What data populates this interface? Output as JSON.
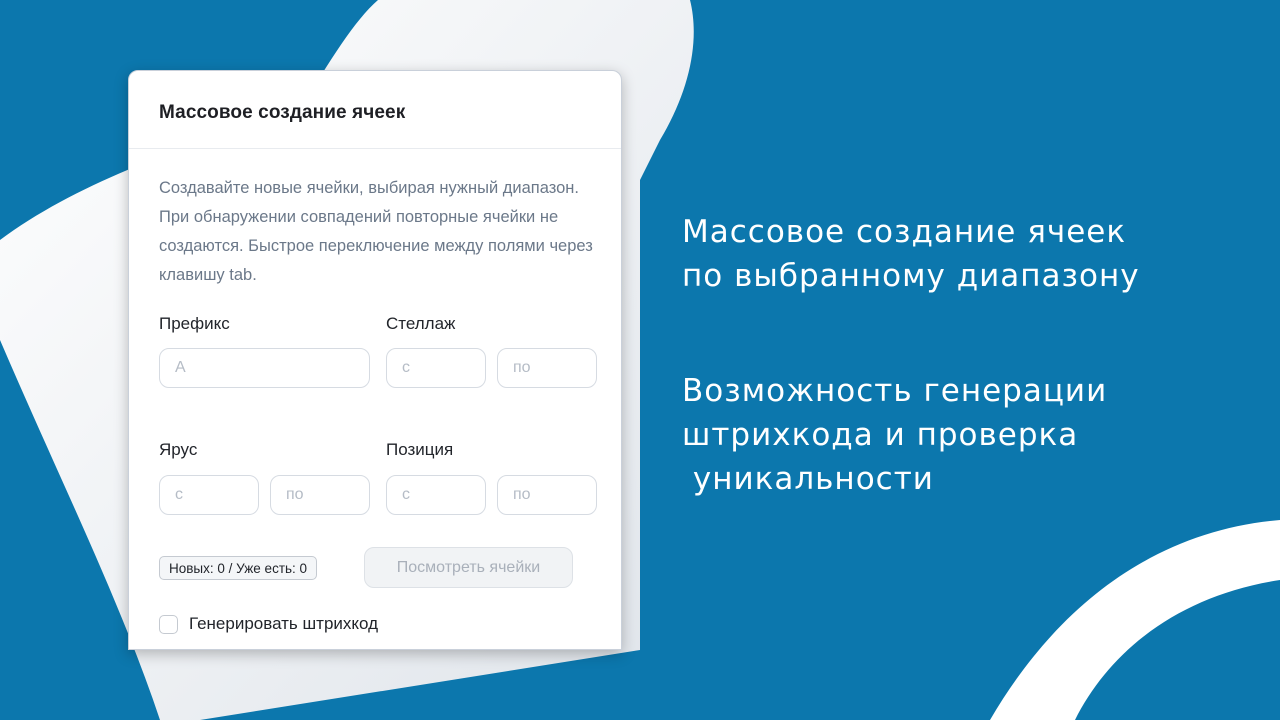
{
  "dialog": {
    "title": "Массовое создание ячеек",
    "description": "Создавайте новые ячейки, выбирая нужный диапазон. При обнаружении совпадений повторные ячейки не создаются. Быстрое переключение между полями через клавишу tab.",
    "prefix": {
      "label": "Префикс",
      "placeholder": "A"
    },
    "rack": {
      "label": "Стеллаж",
      "from_placeholder": "с",
      "to_placeholder": "по"
    },
    "tier": {
      "label": "Ярус",
      "from_placeholder": "с",
      "to_placeholder": "по"
    },
    "position": {
      "label": "Позиция",
      "from_placeholder": "с",
      "to_placeholder": "по"
    },
    "counter_badge": "Новых: 0 / Уже есть: 0",
    "view_cells_button": "Посмотреть ячейки",
    "barcode_checkbox_label": "Генерировать штрихкод",
    "barcode_checked": false
  },
  "promo": {
    "line1": "Массовое создание ячеек\nпо выбранному диапазону",
    "line2": "Возможность генерации\nштрихкода и проверка\n уникальности"
  },
  "colors": {
    "background": "#0c77ad",
    "shape": "#ffffff"
  }
}
